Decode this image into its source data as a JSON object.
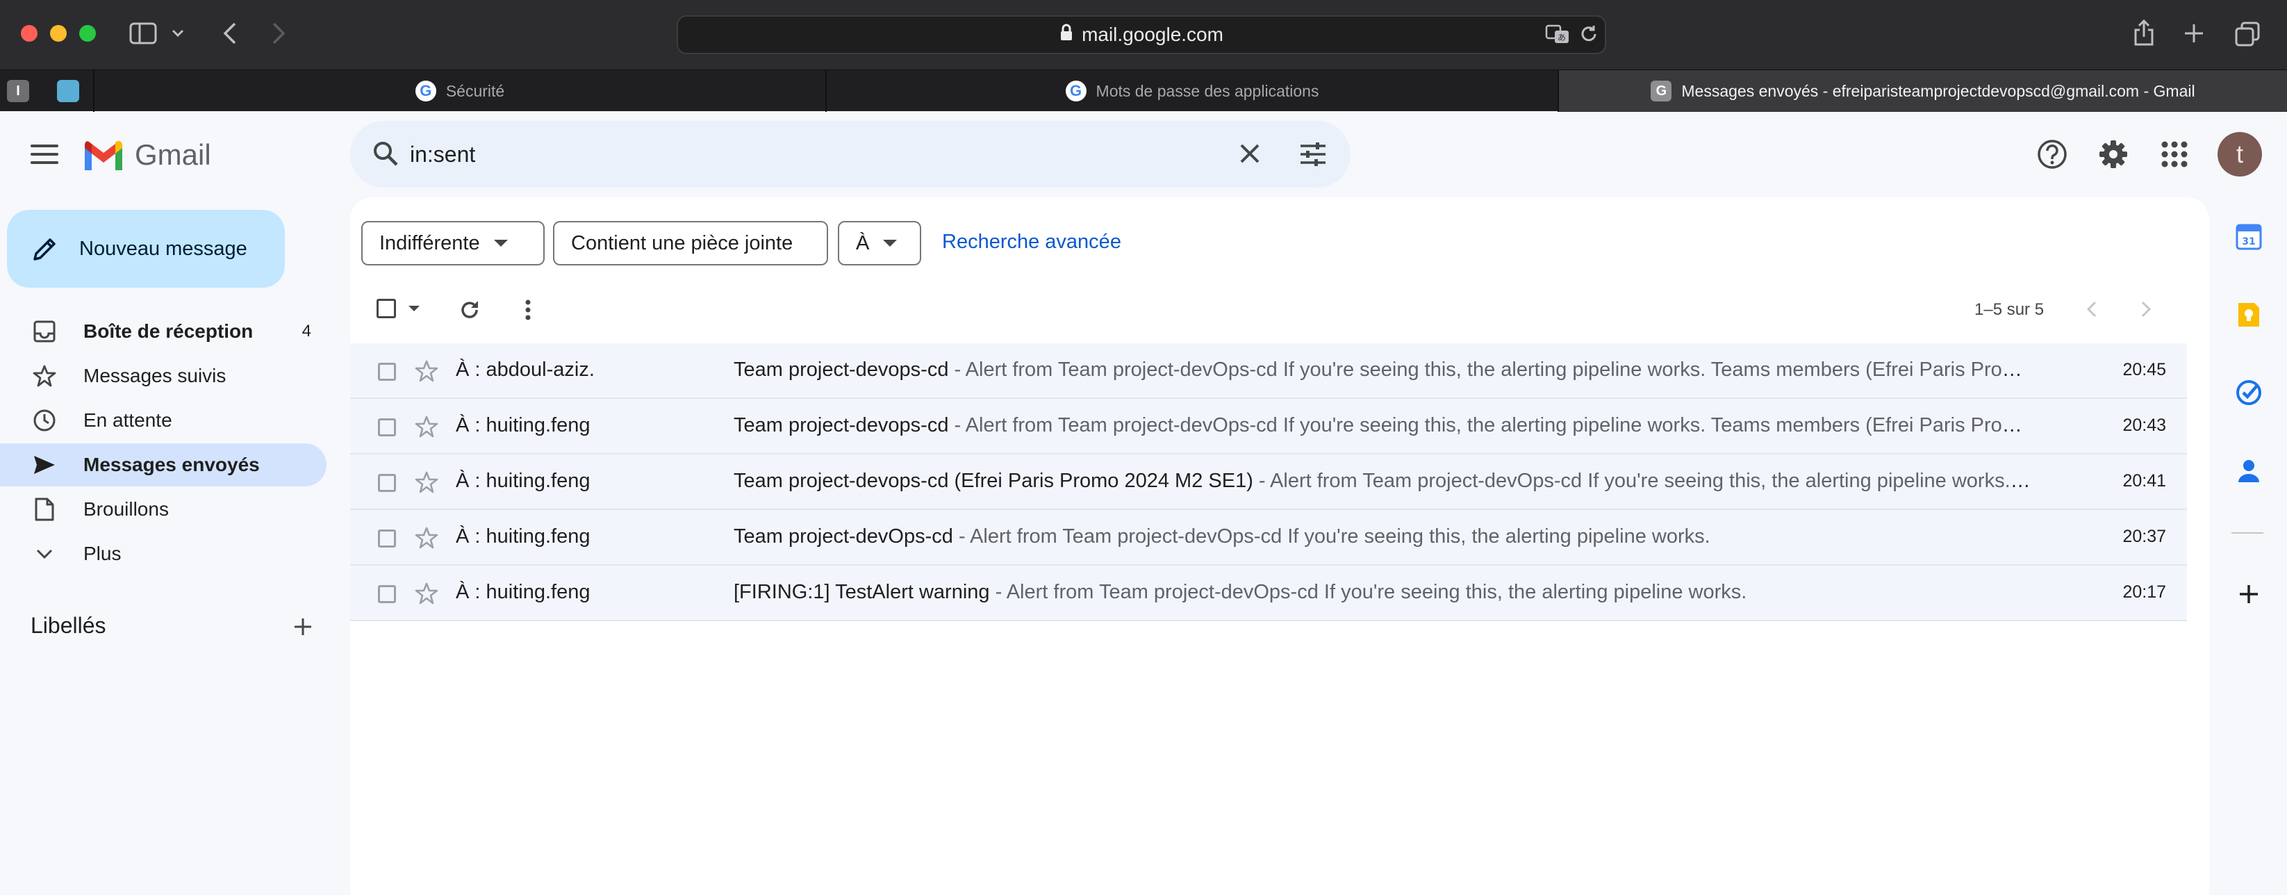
{
  "browser": {
    "url": "mail.google.com",
    "tabs": [
      {
        "label": "Sécurité"
      },
      {
        "label": "Mots de passe des applications"
      },
      {
        "label": "Messages envoyés - efreiparisteamprojectdevopscd@gmail.com - Gmail"
      }
    ],
    "pinned_tab_letter": "I"
  },
  "header": {
    "app_name": "Gmail",
    "search_value": "in:sent",
    "avatar_letter": "t"
  },
  "sidebar": {
    "compose_label": "Nouveau message",
    "items": [
      {
        "label": "Boîte de réception",
        "count": "4",
        "icon": "inbox-icon"
      },
      {
        "label": "Messages suivis",
        "icon": "star-icon"
      },
      {
        "label": "En attente",
        "icon": "clock-icon"
      },
      {
        "label": "Messages envoyés",
        "icon": "send-icon"
      },
      {
        "label": "Brouillons",
        "icon": "draft-icon"
      },
      {
        "label": "Plus",
        "icon": "chevron-down-icon"
      }
    ],
    "labels_title": "Libellés"
  },
  "filters": {
    "chips": [
      "Indifférente",
      "Contient une pièce jointe",
      "À"
    ],
    "advanced_search": "Recherche avancée"
  },
  "toolbar": {
    "pager": "1–5 sur 5"
  },
  "emails": [
    {
      "to": "À : abdoul-aziz.",
      "subject": "Team project-devops-cd",
      "snippet": "Alert from Team project-devOps-cd If you're seeing this, the alerting pipeline works. Teams members (Efrei Paris Prom...",
      "time": "20:45"
    },
    {
      "to": "À : huiting.feng",
      "subject": "Team project-devops-cd",
      "snippet": "Alert from Team project-devOps-cd If you're seeing this, the alerting pipeline works. Teams members (Efrei Paris Prom...",
      "time": "20:43"
    },
    {
      "to": "À : huiting.feng",
      "subject": "Team project-devops-cd (Efrei Paris Promo 2024 M2 SE1)",
      "snippet": "Alert from Team project-devOps-cd If you're seeing this, the alerting pipeline works. T...",
      "time": "20:41"
    },
    {
      "to": "À : huiting.feng",
      "subject": "Team project-devOps-cd",
      "snippet": "Alert from Team project-devOps-cd If you're seeing this, the alerting pipeline works.",
      "time": "20:37"
    },
    {
      "to": "À : huiting.feng",
      "subject": "[FIRING:1] TestAlert warning",
      "snippet": "Alert from Team project-devOps-cd If you're seeing this, the alerting pipeline works.",
      "time": "20:17"
    }
  ],
  "separator": " - ",
  "colors": {
    "accent": "#0b57d0",
    "compose_bg": "#c2e7ff",
    "active_nav_bg": "#d3e3fd",
    "search_bg": "#eaf1fb"
  }
}
